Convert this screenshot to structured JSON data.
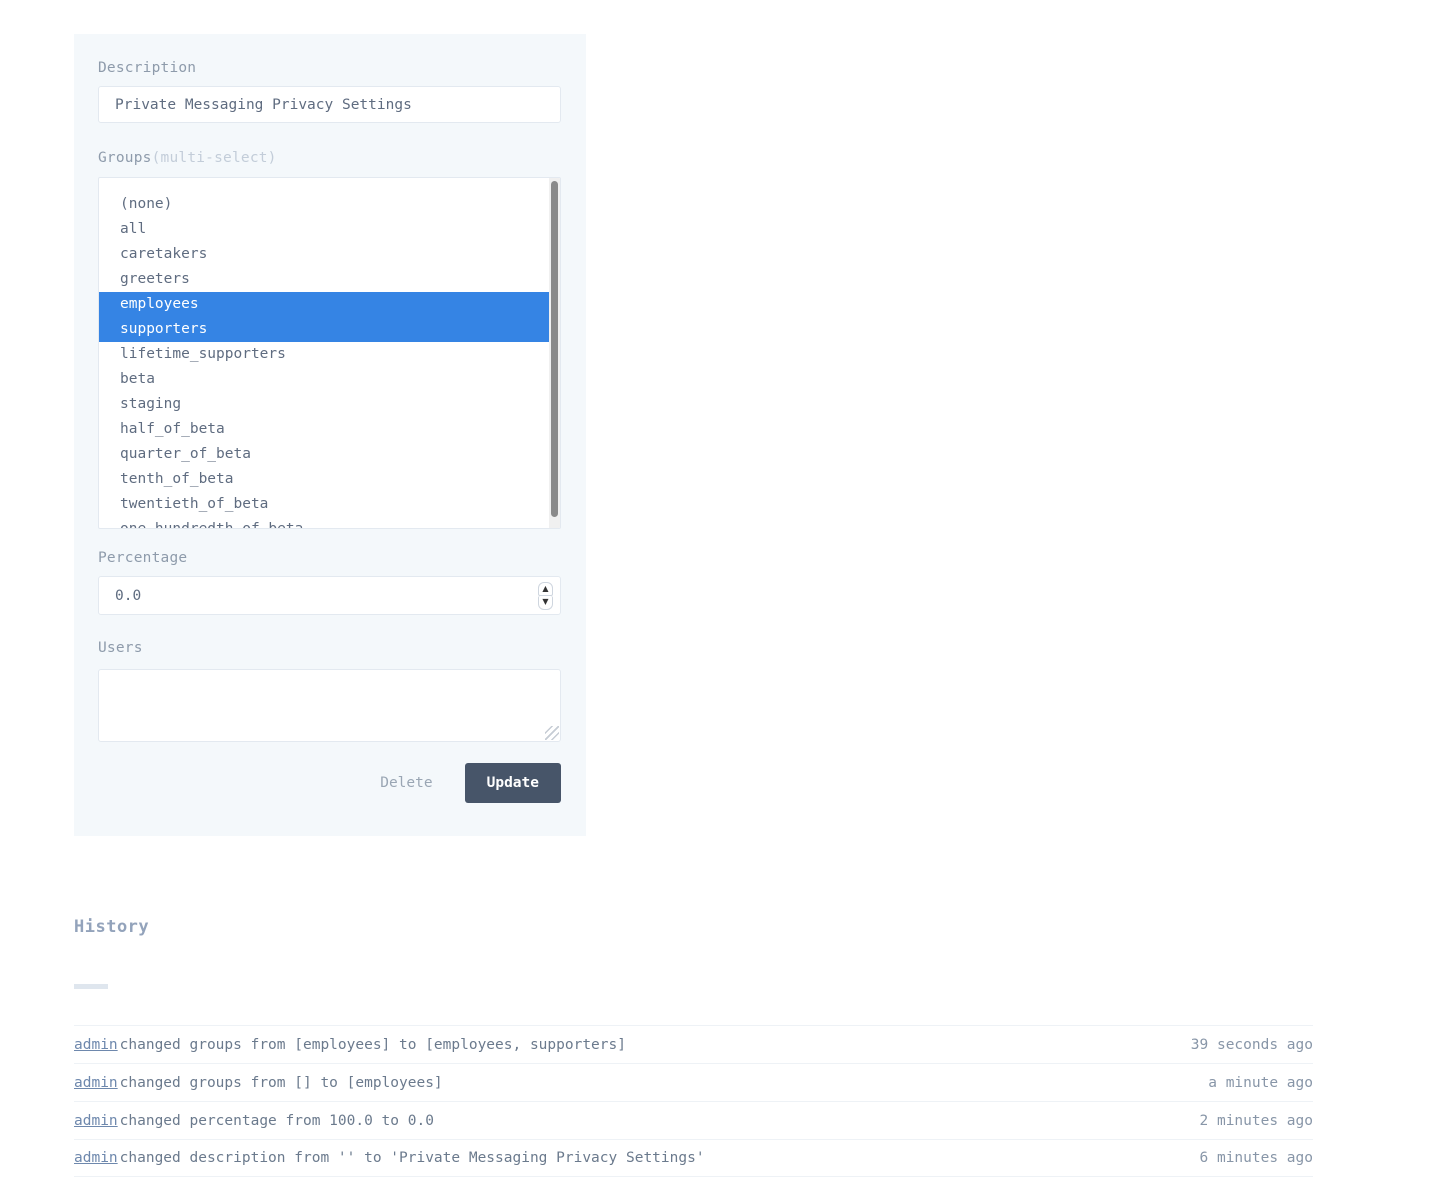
{
  "form": {
    "description": {
      "label": "Description",
      "value": "Private Messaging Privacy Settings",
      "placeholder": ""
    },
    "groups": {
      "label": "Groups",
      "label_suffix": "(multi-select)",
      "options": [
        {
          "label": "(none)",
          "selected": false
        },
        {
          "label": "all",
          "selected": false
        },
        {
          "label": "caretakers",
          "selected": false
        },
        {
          "label": "greeters",
          "selected": false
        },
        {
          "label": "employees",
          "selected": true
        },
        {
          "label": "supporters",
          "selected": true
        },
        {
          "label": "lifetime_supporters",
          "selected": false
        },
        {
          "label": "beta",
          "selected": false
        },
        {
          "label": "staging",
          "selected": false
        },
        {
          "label": "half_of_beta",
          "selected": false
        },
        {
          "label": "quarter_of_beta",
          "selected": false
        },
        {
          "label": "tenth_of_beta",
          "selected": false
        },
        {
          "label": "twentieth_of_beta",
          "selected": false
        },
        {
          "label": "one_hundredth_of_beta",
          "selected": false
        }
      ]
    },
    "percentage": {
      "label": "Percentage",
      "value": "0.0",
      "spinner_up": "▲",
      "spinner_down": "▼"
    },
    "users": {
      "label": "Users",
      "value": "",
      "placeholder": ""
    },
    "delete_label": "Delete",
    "update_label": "Update"
  },
  "history": {
    "title": "History",
    "rows": [
      {
        "actor": "admin",
        "text": "changed groups from [employees] to [employees, supporters]",
        "time": "39 seconds ago"
      },
      {
        "actor": "admin",
        "text": "changed groups from [] to [employees]",
        "time": "a minute ago"
      },
      {
        "actor": "admin",
        "text": "changed percentage from 100.0 to 0.0",
        "time": "2 minutes ago"
      },
      {
        "actor": "admin",
        "text": "changed description from '' to 'Private Messaging Privacy Settings'",
        "time": "6 minutes ago"
      }
    ]
  },
  "colors": {
    "panel_bg": "#f4f8fb",
    "selection_blue": "#3584e4",
    "primary_button": "#475569",
    "link": "#6e88ad"
  }
}
